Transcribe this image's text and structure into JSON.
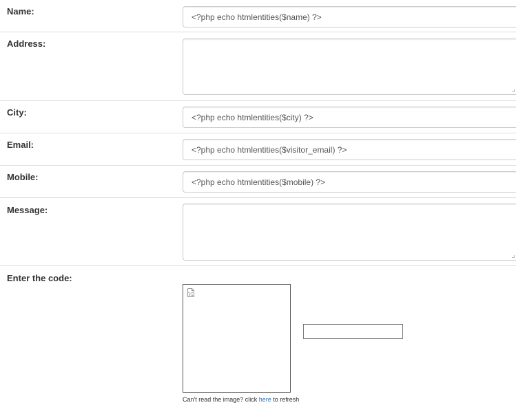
{
  "form": {
    "name": {
      "label": "Name:",
      "value": "<?php echo htmlentities($name) ?>"
    },
    "address": {
      "label": "Address:",
      "value": ""
    },
    "city": {
      "label": "City:",
      "value": "<?php echo htmlentities($city) ?>"
    },
    "email": {
      "label": "Email:",
      "value": "<?php echo htmlentities($visitor_email) ?>"
    },
    "mobile": {
      "label": "Mobile:",
      "value": "<?php echo htmlentities($mobile) ?>"
    },
    "message": {
      "label": "Message:",
      "value": ""
    },
    "captcha": {
      "label": "Enter the code:",
      "image_icon": "broken-image-icon",
      "code_value": "",
      "refresh_prefix": "Can't read the image? click ",
      "refresh_link": "here",
      "refresh_suffix": " to refresh"
    }
  },
  "colors": {
    "link": "#2a6ebb",
    "divider": "#dddddd",
    "field_border": "#cccccc"
  }
}
